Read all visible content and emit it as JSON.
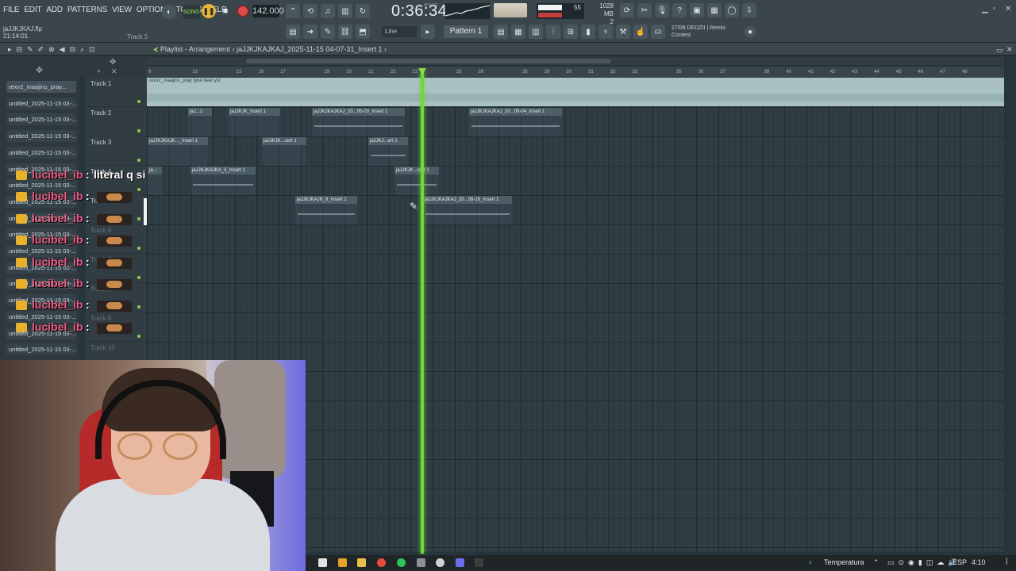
{
  "menu": [
    "FILE",
    "EDIT",
    "ADD",
    "PATTERNS",
    "VIEW",
    "OPTIONS",
    "TOOLS",
    "HELP"
  ],
  "project": {
    "filename": "jaJJKJKAJ.flp",
    "time": "21:14:01",
    "hint_track": "Track 5"
  },
  "transport": {
    "mode": "SONG",
    "tempo": "142.000",
    "time": "0:36:34",
    "time_unit": "M:S:CS"
  },
  "monitor": {
    "mem": "1028 MB",
    "cpu": "55",
    "voices": "2"
  },
  "toolbar": {
    "snap": "Line",
    "pattern": "Pattern 1",
    "hint_date": "27/08",
    "hint_title": "DEDZII | Remix",
    "hint_sub": "Contest"
  },
  "playlist": {
    "title": "Playlist - Arrangement",
    "subtitle": "jaJJKJKAJKAJ_2025-11-15 04-07-31_Insert 1"
  },
  "ruler": [
    "9",
    "",
    "13",
    "",
    "15",
    "16",
    "17",
    "",
    "19",
    "20",
    "21",
    "22",
    "23",
    "",
    "25",
    "26",
    "",
    "28",
    "29",
    "30",
    "31",
    "32",
    "33",
    "",
    "35",
    "36",
    "37",
    "",
    "39",
    "40",
    "41",
    "42",
    "43",
    "44",
    "45",
    "46",
    "47",
    "48"
  ],
  "browser": [
    "rexv2_maajins_pray...",
    "untitled_2025-11-15 03-...",
    "untitled_2025-11-15 03-...",
    "untitled_2025-11-15 03-...",
    "untitled_2025-11-15 03-...",
    "untitled_2025-11-15 03-...",
    "untitled_2025-11-15 03-...",
    "untitled_2025-11-15 03-...",
    "untitled_2025-11-15 03-...",
    "untitled_2025-11-15 03-...",
    "untitled_2025-11-15 03-...",
    "untitled_2025-11-15 03-...",
    "untitled_2025-11-15 03-...",
    "untitled_2025-11-15 03-...",
    "untitled_2025-11-15 03-...",
    "untitled_2025-11-15 03-...",
    "untitled_2025-11-15 03-..."
  ],
  "tracks": [
    "Track 1",
    "Track 2",
    "Track 3",
    "Track 4",
    "Track 5",
    "Track 6",
    "Track 7",
    "Track 8",
    "Track 9",
    "Track 10"
  ],
  "clips": {
    "track1": "rexv2_maajins_pray type beat ysl",
    "c2a": "jaJ...1",
    "c2b": "jaJJKJK_Insert 1",
    "c2c": "jaJJKJKAJKAJ_20...05-03_Insert 1",
    "c2d": "jaJJKJKAJKAJ_20...09-04_Insert 1",
    "c3a": "jaJJKJKAJK..._Insert 1",
    "c3b": "jaJJKJK...sert 1",
    "c3c": "jaJJKJ...ert 1",
    "c4a": "ja...",
    "c4b": "jaJJKJKAJKA_3_Insert 1",
    "c4c": "jaJJKJK...sert 1",
    "c5a": "jaJJKJKAJK_8_Insert 1",
    "c5b": "jaJJKJKAJKAJ_20...08-16_Insert 1"
  },
  "chat": [
    {
      "name": "lucibel_ib",
      "msg": "literal q si"
    },
    {
      "name": "lucibel_ib",
      "msg": ""
    },
    {
      "name": "lucibel_ib",
      "msg": ""
    },
    {
      "name": "lucibel_ib",
      "msg": ""
    },
    {
      "name": "lucibel_ib",
      "msg": ""
    },
    {
      "name": "lucibel_ib",
      "msg": ""
    },
    {
      "name": "lucibel_ib",
      "msg": ""
    },
    {
      "name": "lucibel_ib",
      "msg": ""
    }
  ],
  "tray": {
    "weather": "Temperatura",
    "lang": "ESP",
    "clock": "4:10"
  },
  "colors": {
    "playhead": "#6fd83a",
    "chat_name": "#ec5b83",
    "accent": "#e6b43a"
  }
}
